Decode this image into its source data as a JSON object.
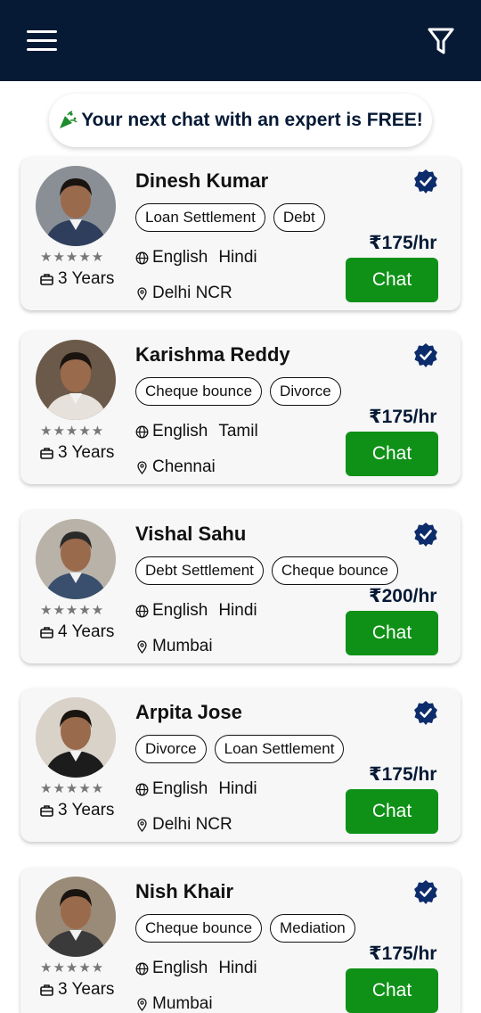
{
  "banner": {
    "text": "Your next chat with an expert is FREE!"
  },
  "colors": {
    "navy": "#061a36",
    "chat_green": "#0f9117",
    "card_bg": "#f7f7f7"
  },
  "icons": {
    "menu": "hamburger-icon",
    "filter": "filter-icon",
    "verified": "verified-badge-icon",
    "language": "globe-icon",
    "location": "location-pin-icon",
    "experience": "briefcase-icon",
    "star": "star-icon"
  },
  "experts": [
    {
      "name": "Dinesh Kumar",
      "rating": "★★★★★",
      "tags": [
        "Loan Settlement",
        "Debt"
      ],
      "lang1": "English",
      "lang2": "Hindi",
      "location": "Delhi NCR",
      "experience": "3 Years",
      "price": "₹175/hr",
      "chat": "Chat"
    },
    {
      "name": "Karishma Reddy",
      "rating": "★★★★★",
      "tags": [
        "Cheque bounce",
        "Divorce"
      ],
      "lang1": "English",
      "lang2": "Tamil",
      "location": "Chennai",
      "experience": "3 Years",
      "price": "₹175/hr",
      "chat": "Chat"
    },
    {
      "name": "Vishal Sahu",
      "rating": "★★★★★",
      "tags": [
        "Debt Settlement",
        "Cheque bounce"
      ],
      "lang1": "English",
      "lang2": "Hindi",
      "location": "Mumbai",
      "experience": "4 Years",
      "price": "₹200/hr",
      "chat": "Chat"
    },
    {
      "name": "Arpita Jose",
      "rating": "★★★★★",
      "tags": [
        "Divorce",
        "Loan Settlement"
      ],
      "lang1": "English",
      "lang2": "Hindi",
      "location": "Delhi NCR",
      "experience": "3 Years",
      "price": "₹175/hr",
      "chat": "Chat"
    },
    {
      "name": "Nish Khair",
      "rating": "★★★★★",
      "tags": [
        "Cheque bounce",
        "Mediation"
      ],
      "lang1": "English",
      "lang2": "Hindi",
      "location": "Mumbai",
      "experience": "3 Years",
      "price": "₹175/hr",
      "chat": "Chat"
    }
  ]
}
